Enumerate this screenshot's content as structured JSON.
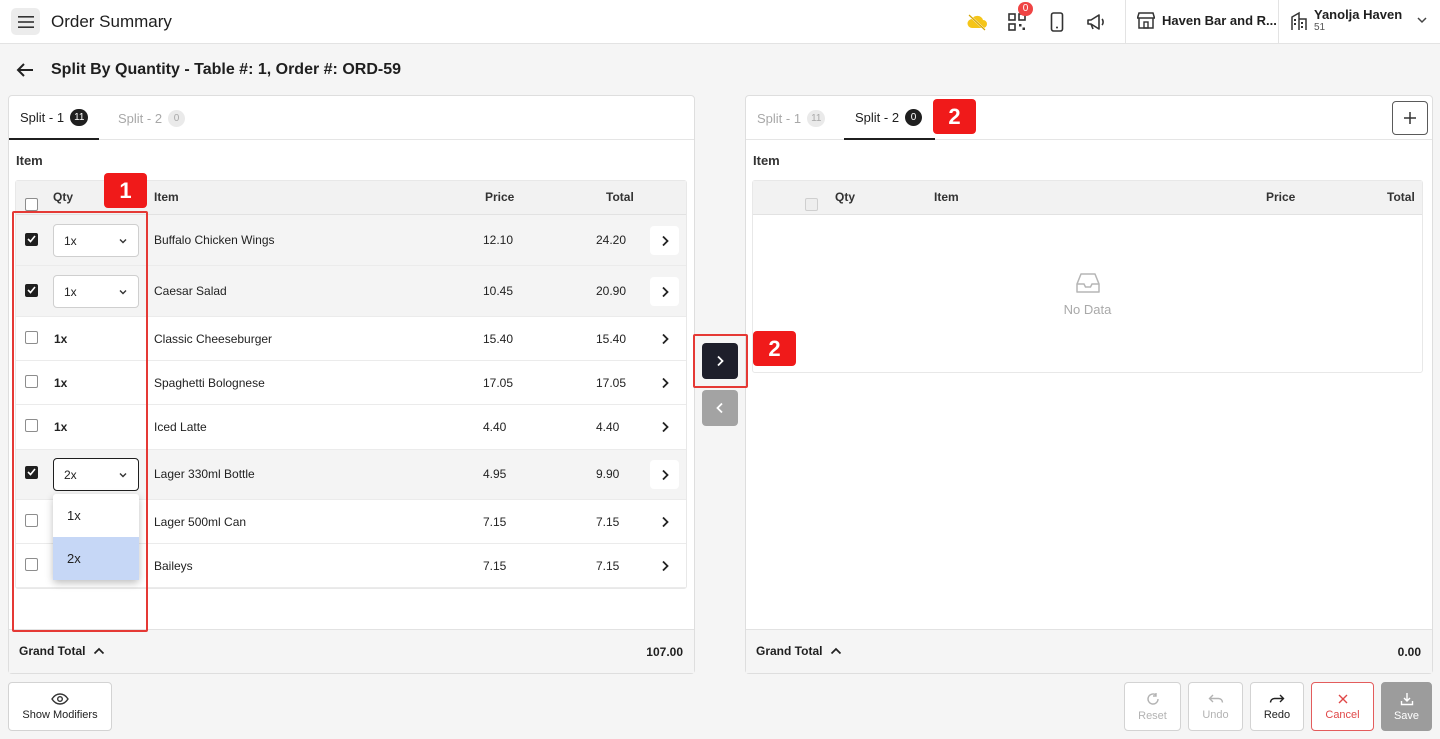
{
  "header": {
    "title": "Order Summary",
    "notification_count": "0",
    "venue_name": "Haven Bar and R...",
    "account_name": "Yanolja Haven",
    "account_sub": "51"
  },
  "page": {
    "title": "Split By Quantity - Table #: 1, Order #: ORD-59"
  },
  "left_panel": {
    "tabs": [
      {
        "label": "Split - 1",
        "count": "11"
      },
      {
        "label": "Split - 2",
        "count": "0"
      }
    ],
    "section_label": "Item",
    "columns": {
      "qty": "Qty",
      "item": "Item",
      "price": "Price",
      "total": "Total"
    },
    "rows": [
      {
        "checked": true,
        "qty": "1x",
        "item": "Buffalo Chicken Wings",
        "price": "12.10",
        "total": "24.20"
      },
      {
        "checked": true,
        "qty": "1x",
        "item": "Caesar Salad",
        "price": "10.45",
        "total": "20.90"
      },
      {
        "checked": false,
        "qty": "1x",
        "item": "Classic Cheeseburger",
        "price": "15.40",
        "total": "15.40"
      },
      {
        "checked": false,
        "qty": "1x",
        "item": "Spaghetti Bolognese",
        "price": "17.05",
        "total": "17.05"
      },
      {
        "checked": false,
        "qty": "1x",
        "item": "Iced Latte",
        "price": "4.40",
        "total": "4.40"
      },
      {
        "checked": true,
        "qty": "2x",
        "item": "Lager 330ml Bottle",
        "price": "4.95",
        "total": "9.90"
      },
      {
        "checked": false,
        "qty": "1x",
        "item": "Lager 500ml Can",
        "price": "7.15",
        "total": "7.15"
      },
      {
        "checked": false,
        "qty": "1x",
        "item": "Baileys",
        "price": "7.15",
        "total": "7.15"
      }
    ],
    "dropdown_options": [
      "1x",
      "2x"
    ],
    "grand_total_label": "Grand Total",
    "grand_total_value": "107.00"
  },
  "right_panel": {
    "tabs": [
      {
        "label": "Split - 1",
        "count": "11"
      },
      {
        "label": "Split - 2",
        "count": "0"
      }
    ],
    "section_label": "Item",
    "columns": {
      "qty": "Qty",
      "item": "Item",
      "price": "Price",
      "total": "Total"
    },
    "empty_text": "No Data",
    "grand_total_label": "Grand Total",
    "grand_total_value": "0.00"
  },
  "annotations": [
    "1",
    "2",
    "2"
  ],
  "footer": {
    "show_modifiers": "Show Modifiers",
    "reset": "Reset",
    "undo": "Undo",
    "redo": "Redo",
    "cancel": "Cancel",
    "save": "Save"
  },
  "colors": {
    "accent_dark": "#1e1f2b",
    "annotation_red": "#f01a1a",
    "dropdown_highlight": "#c6d7f6",
    "cancel_red": "#e04848"
  }
}
